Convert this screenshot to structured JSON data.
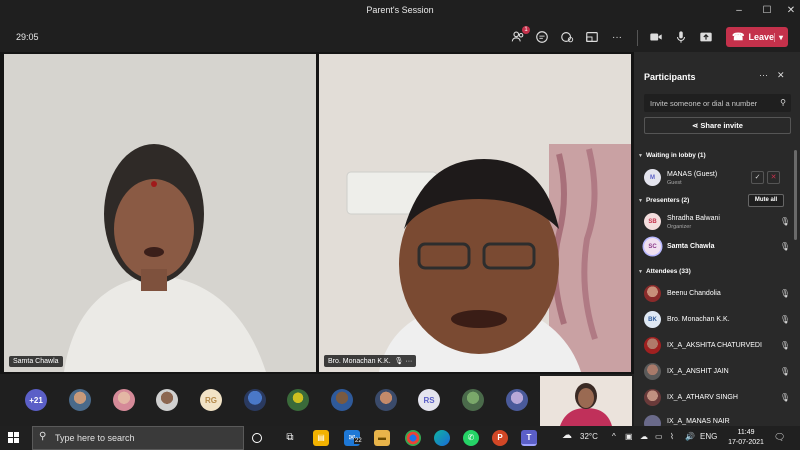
{
  "window": {
    "title": "Parent's Session",
    "minimize": "–",
    "maximize": "☐",
    "close": "✕"
  },
  "toolbar": {
    "timer": "29:05",
    "participants_badge": "1",
    "more": "···",
    "leave_label": "Leave"
  },
  "videos": [
    {
      "name": "Samta Chawla"
    },
    {
      "name": "Bro. Monachan K.K."
    }
  ],
  "strip": {
    "overflow_count": "+21",
    "initials": [
      "RG",
      "RS"
    ]
  },
  "panel": {
    "title": "Participants",
    "more": "···",
    "invite_placeholder": "Invite someone or dial a number",
    "share_invite": "Share invite",
    "lobby_section": "Waiting in lobby (1)",
    "lobby": [
      {
        "initials": "M",
        "name": "MANAS (Guest)",
        "role": "Guest"
      }
    ],
    "presenters_section": "Presenters (2)",
    "mute_all": "Mute all",
    "presenters": [
      {
        "initials": "SB",
        "name": "Shradha Balwani",
        "role": "Organizer"
      },
      {
        "initials": "SC",
        "name": "Samta Chawla",
        "role": ""
      }
    ],
    "attendees_section": "Attendees (33)",
    "attendees": [
      {
        "initials": "",
        "name": "Beenu Chandolia"
      },
      {
        "initials": "BK",
        "name": "Bro. Monachan K.K."
      },
      {
        "initials": "",
        "name": "IX_A_AKSHITA CHATURVEDI"
      },
      {
        "initials": "",
        "name": "IX_A_ANSHIT JAIN"
      },
      {
        "initials": "",
        "name": "IX_A_ATHARV SINGH"
      },
      {
        "initials": "",
        "name": "IX_A_MANAS NAIR"
      }
    ]
  },
  "taskbar": {
    "search_placeholder": "Type here to search",
    "mail_badge": "22",
    "weather": "32°C",
    "language": "ENG",
    "time": "11:49",
    "date": "17-07-2021"
  },
  "colors": {
    "accent": "#5b5fc7",
    "leave": "#c4314b",
    "panel": "#292929",
    "bg": "#1f1f1f"
  }
}
